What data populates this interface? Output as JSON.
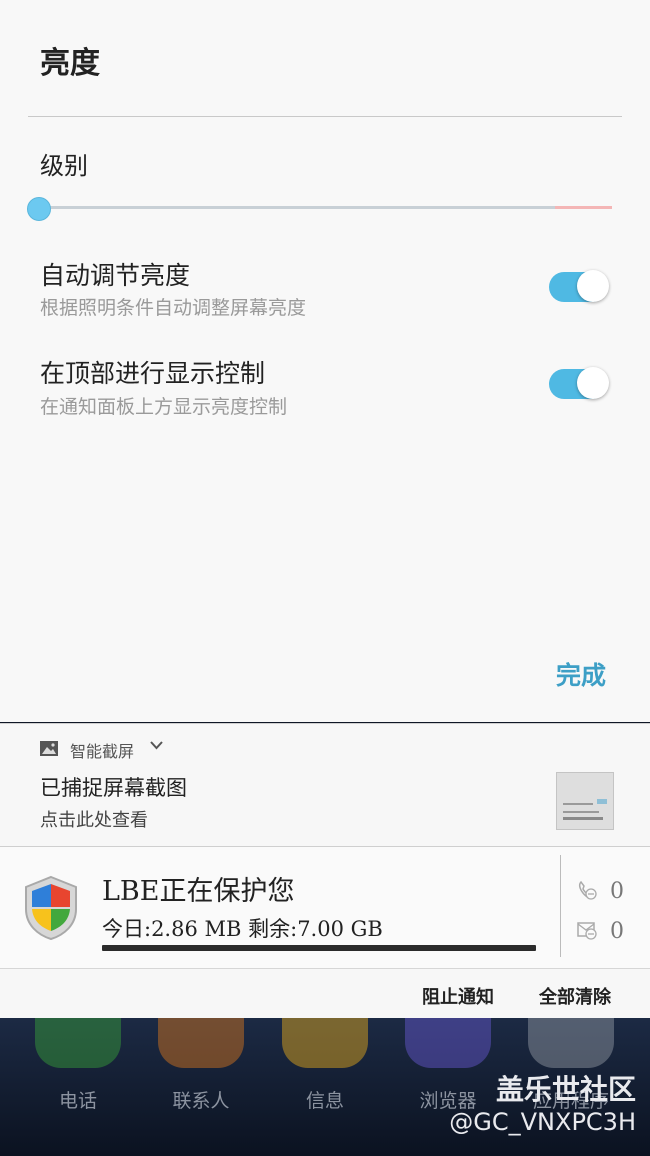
{
  "dialog": {
    "title": "亮度",
    "level_label": "级别",
    "level_value": 0,
    "auto_brightness": {
      "title": "自动调节亮度",
      "subtitle": "根据照明条件自动调整屏幕亮度",
      "enabled": true
    },
    "top_control": {
      "title": "在顶部进行显示控制",
      "subtitle": "在通知面板上方显示亮度控制",
      "enabled": true
    },
    "done_label": "完成"
  },
  "notifications": {
    "screenshot": {
      "app_name": "智能截屏",
      "title": "已捕捉屏幕截图",
      "subtitle": "点击此处查看"
    },
    "lbe": {
      "title": "LBE正在保护您",
      "stats": "今日:2.86 MB 剩余:7.00 GB",
      "calls_blocked": "0",
      "sms_blocked": "0"
    },
    "actions": {
      "block": "阻止通知",
      "clear_all": "全部清除"
    }
  },
  "home_dock": [
    {
      "label": "电话",
      "color": "#3aa63a"
    },
    {
      "label": "联系人",
      "color": "#e07b1c"
    },
    {
      "label": "信息",
      "color": "#f0b21a"
    },
    {
      "label": "浏览器",
      "color": "#6b5bd6"
    },
    {
      "label": "应用程序",
      "color": "#9aa0a8"
    }
  ],
  "watermark": {
    "brand": "盖乐世社区",
    "user": "@GC_VNXPC3H"
  },
  "colors": {
    "accent": "#4fb9e3",
    "done": "#3d9fc6"
  }
}
